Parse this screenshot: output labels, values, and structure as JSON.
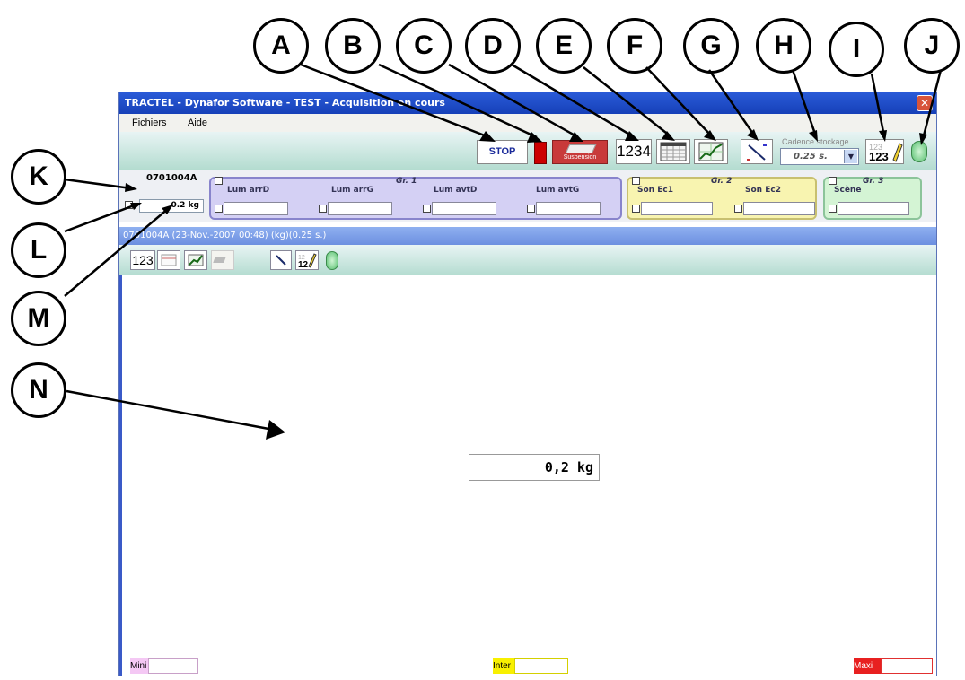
{
  "window": {
    "title": "TRACTEL - Dynafor Software - TEST - Acquisition en cours",
    "close_glyph": "✕"
  },
  "menu": {
    "items": [
      "Fichiers",
      "Aide"
    ]
  },
  "toolbar": {
    "stop_label": "STOP",
    "suspension_label": "Suspension",
    "numeric_label": "1234",
    "cadence_label": "Cadence stockage",
    "cadence_value": "0.25 s."
  },
  "sensor": {
    "id": "0701004A",
    "value": "0.2 kg"
  },
  "groups": [
    {
      "title": "Gr. 1",
      "channels": [
        "Lum arrD",
        "Lum arrG",
        "Lum avtD",
        "Lum avtG"
      ],
      "color": "#d4d0f4"
    },
    {
      "title": "Gr. 2",
      "channels": [
        "Son Ec1",
        "Son Ec2"
      ],
      "color": "#f8f4b0"
    },
    {
      "title": "Gr. 3",
      "channels": [
        "Scène"
      ],
      "color": "#d4f4d4"
    }
  ],
  "panel": {
    "title": "0701004A (23-Nov.-2007 00:48) (kg)(0.25 s.)",
    "numeric_label": "123",
    "main_value": "0,2 kg"
  },
  "footer": {
    "mini": "Mini",
    "inter": "Inter",
    "maxi": "Maxi"
  },
  "callouts": [
    "A",
    "B",
    "C",
    "D",
    "E",
    "F",
    "G",
    "H",
    "I",
    "J",
    "K",
    "L",
    "M",
    "N"
  ],
  "icons": [
    "close-icon",
    "suspension-icon",
    "table-icon",
    "graph-icon",
    "gauge-icon",
    "edit-icon",
    "dropdown-arrow-icon",
    "led-indicator-icon"
  ]
}
